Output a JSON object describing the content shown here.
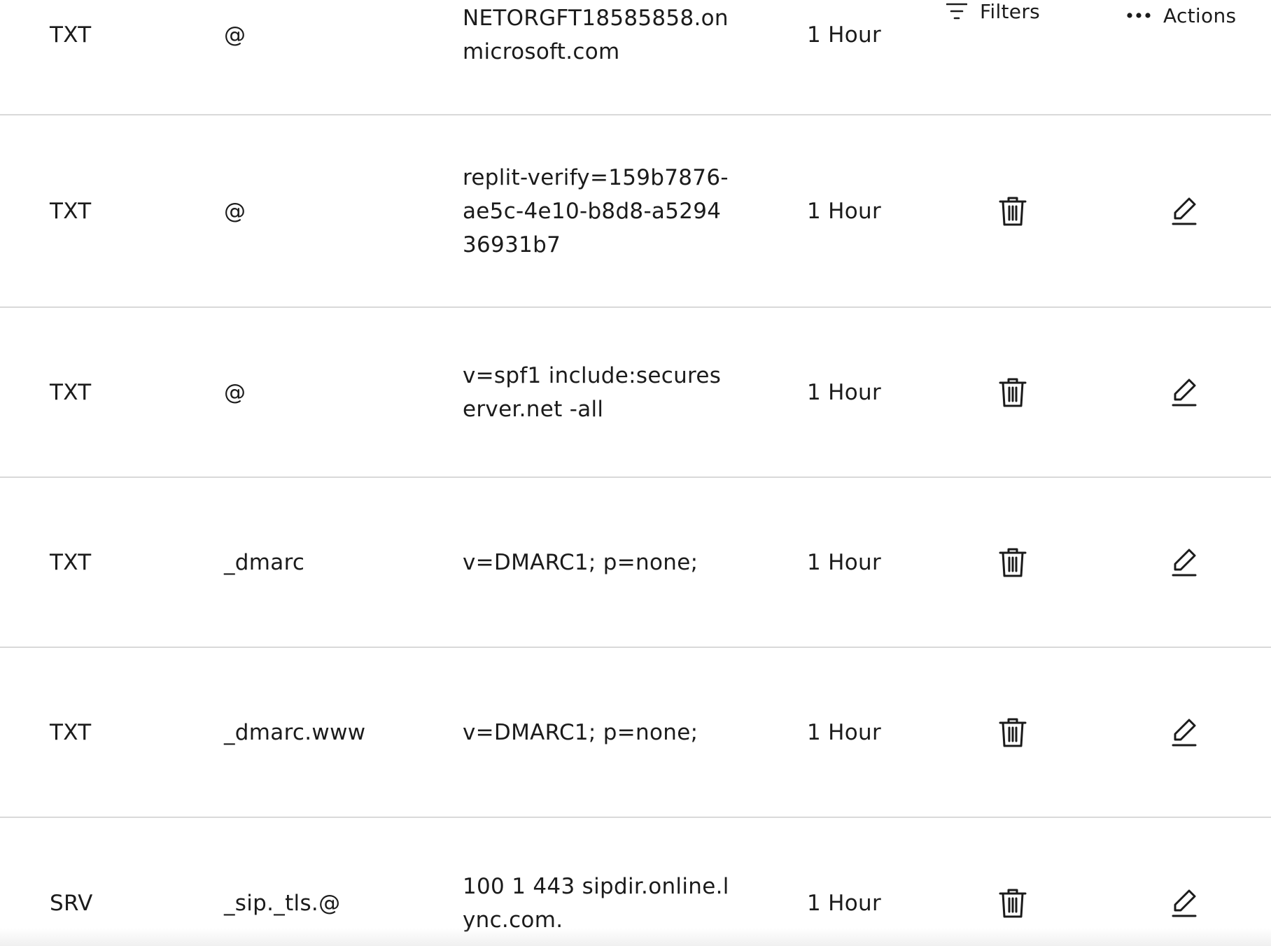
{
  "toolbar": {
    "filters_label": "Filters",
    "actions_label": "Actions"
  },
  "records": [
    {
      "type": "TXT",
      "name": "@",
      "data": "NETORGFT18585858.onmicrosoft.com",
      "ttl": "1 Hour"
    },
    {
      "type": "TXT",
      "name": "@",
      "data": "replit-verify=159b7876-ae5c-4e10-b8d8-a529436931b7",
      "ttl": "1 Hour"
    },
    {
      "type": "TXT",
      "name": "@",
      "data": "v=spf1 include:secureserver.net -all",
      "ttl": "1 Hour"
    },
    {
      "type": "TXT",
      "name": "_dmarc",
      "data": "v=DMARC1; p=none;",
      "ttl": "1 Hour"
    },
    {
      "type": "TXT",
      "name": "_dmarc.www",
      "data": "v=DMARC1; p=none;",
      "ttl": "1 Hour"
    },
    {
      "type": "SRV",
      "name": "_sip._tls.@",
      "data": "100 1 443 sipdir.online.lync.com.",
      "ttl": "1 Hour"
    }
  ],
  "icons": {
    "delete": "trash-icon",
    "edit": "pencil-icon",
    "filters": "filter-icon",
    "actions": "more-horizontal-icon"
  }
}
